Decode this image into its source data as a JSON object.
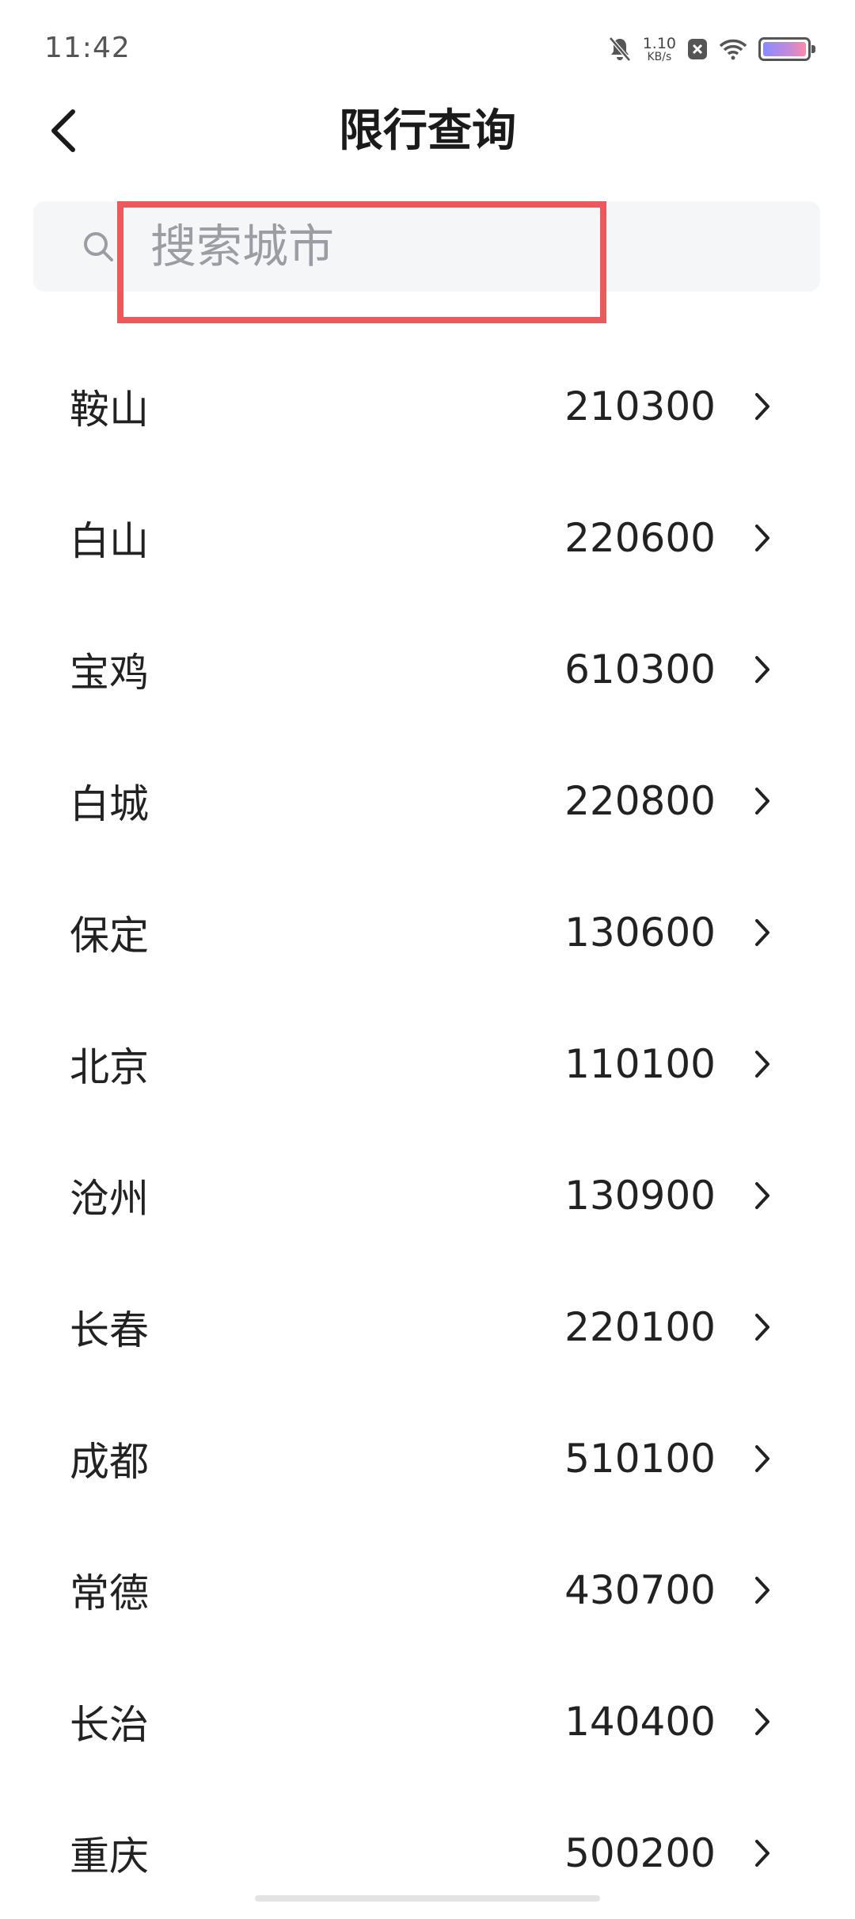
{
  "status_bar": {
    "time": "11:42",
    "net_speed_value": "1.10",
    "net_speed_unit": "KB/s",
    "icons": [
      "bell-off-icon",
      "close-box-icon",
      "wifi-icon",
      "battery-icon"
    ]
  },
  "nav": {
    "back_icon": "chevron-left-icon",
    "title": "限行查询"
  },
  "search": {
    "placeholder": "搜索城市",
    "value": "",
    "icon": "search-icon"
  },
  "colors": {
    "highlight": "#ea5a5a",
    "search_bg": "#f5f6f8",
    "placeholder": "#9a9da3"
  },
  "cities": [
    {
      "name": "鞍山",
      "code": "210300"
    },
    {
      "name": "白山",
      "code": "220600"
    },
    {
      "name": "宝鸡",
      "code": "610300"
    },
    {
      "name": "白城",
      "code": "220800"
    },
    {
      "name": "保定",
      "code": "130600"
    },
    {
      "name": "北京",
      "code": "110100"
    },
    {
      "name": "沧州",
      "code": "130900"
    },
    {
      "name": "长春",
      "code": "220100"
    },
    {
      "name": "成都",
      "code": "510100"
    },
    {
      "name": "常德",
      "code": "430700"
    },
    {
      "name": "长治",
      "code": "140400"
    },
    {
      "name": "重庆",
      "code": "500200"
    }
  ]
}
